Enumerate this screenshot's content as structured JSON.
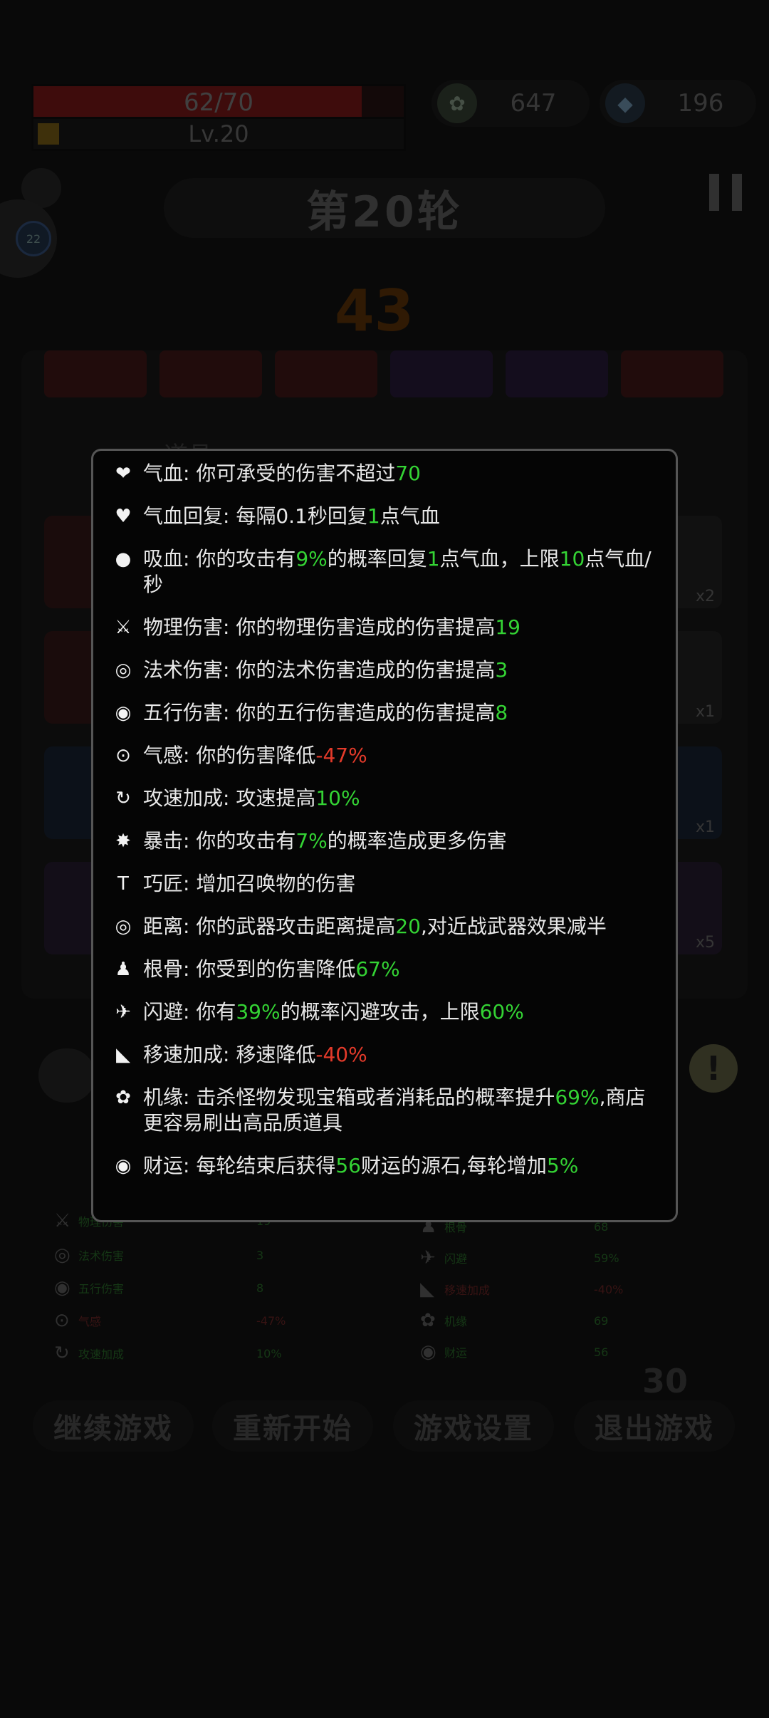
{
  "hud": {
    "hp_text": "62/70",
    "hp_fraction": 0.886,
    "level_text": "Lv.20",
    "currency1": "647",
    "currency2": "196",
    "round_title": "第20轮",
    "countdown": "43",
    "float_badge": "22"
  },
  "background": {
    "section_label": "道具",
    "tile_qty": [
      "x2",
      "x1",
      "x1",
      "x5"
    ],
    "counter": "30",
    "stats_left": [
      {
        "name": "物理伤害",
        "value": "19"
      },
      {
        "name": "法术伤害",
        "value": "3"
      },
      {
        "name": "五行伤害",
        "value": "8"
      },
      {
        "name": "气感",
        "value": "-47%"
      },
      {
        "name": "攻速加成",
        "value": "10%"
      }
    ],
    "stats_right": [
      {
        "name": "根骨",
        "value": "68"
      },
      {
        "name": "闪避",
        "value": "59%"
      },
      {
        "name": "移速加成",
        "value": "-40%"
      },
      {
        "name": "机缘",
        "value": "69"
      },
      {
        "name": "财运",
        "value": "56"
      }
    ]
  },
  "tooltip": {
    "rows": [
      {
        "icon": "heart-icon",
        "glyph": "❤",
        "parts": [
          {
            "t": "气血: 你可承受的伤害不超过"
          },
          {
            "t": "70",
            "c": "g"
          }
        ]
      },
      {
        "icon": "heart-regen-icon",
        "glyph": "♥",
        "parts": [
          {
            "t": "气血回复: 每隔0.1秒回复"
          },
          {
            "t": "1",
            "c": "g"
          },
          {
            "t": "点气血"
          }
        ]
      },
      {
        "icon": "blood-drop-icon",
        "glyph": "●",
        "parts": [
          {
            "t": "吸血: 你的攻击有"
          },
          {
            "t": "9%",
            "c": "g"
          },
          {
            "t": "的概率回复"
          },
          {
            "t": "1",
            "c": "g"
          },
          {
            "t": "点气血，上限"
          },
          {
            "t": "10",
            "c": "g"
          },
          {
            "t": "点气血/秒"
          }
        ]
      },
      {
        "icon": "sword-icon",
        "glyph": "⚔",
        "parts": [
          {
            "t": "物理伤害: 你的物理伤害造成的伤害提高"
          },
          {
            "t": "19",
            "c": "g"
          }
        ]
      },
      {
        "icon": "swirl-icon",
        "glyph": "◎",
        "parts": [
          {
            "t": "法术伤害: 你的法术伤害造成的伤害提高"
          },
          {
            "t": "3",
            "c": "g"
          }
        ]
      },
      {
        "icon": "five-elements-icon",
        "glyph": "◉",
        "parts": [
          {
            "t": "五行伤害: 你的五行伤害造成的伤害提高"
          },
          {
            "t": "8",
            "c": "g"
          }
        ]
      },
      {
        "icon": "qi-sense-icon",
        "glyph": "⊙",
        "parts": [
          {
            "t": "气感: 你的伤害降低"
          },
          {
            "t": "-47%",
            "c": "r"
          }
        ]
      },
      {
        "icon": "attack-speed-icon",
        "glyph": "↻",
        "parts": [
          {
            "t": "攻速加成: 攻速提高"
          },
          {
            "t": "10%",
            "c": "g"
          }
        ]
      },
      {
        "icon": "critical-icon",
        "glyph": "✸",
        "parts": [
          {
            "t": "暴击: 你的攻击有"
          },
          {
            "t": "7%",
            "c": "g"
          },
          {
            "t": "的概率造成更多伤害"
          }
        ]
      },
      {
        "icon": "hammer-icon",
        "glyph": "T",
        "parts": [
          {
            "t": "巧匠: 增加召唤物的伤害"
          }
        ]
      },
      {
        "icon": "range-icon",
        "glyph": "◎",
        "parts": [
          {
            "t": "距离: 你的武器攻击距离提高"
          },
          {
            "t": "20",
            "c": "g"
          },
          {
            "t": ",对近战武器效果减半"
          }
        ]
      },
      {
        "icon": "meditation-icon",
        "glyph": "♟",
        "parts": [
          {
            "t": "根骨: 你受到的伤害降低"
          },
          {
            "t": "67%",
            "c": "g"
          }
        ]
      },
      {
        "icon": "dodge-icon",
        "glyph": "✈",
        "parts": [
          {
            "t": "闪避: 你有"
          },
          {
            "t": "39%",
            "c": "g"
          },
          {
            "t": "的概率闪避攻击，上限"
          },
          {
            "t": "60%",
            "c": "g"
          }
        ]
      },
      {
        "icon": "boot-icon",
        "glyph": "◣",
        "parts": [
          {
            "t": "移速加成: 移速降低"
          },
          {
            "t": "-40%",
            "c": "r"
          }
        ]
      },
      {
        "icon": "fortune-cycle-icon",
        "glyph": "✿",
        "parts": [
          {
            "t": "机缘: 击杀怪物发现宝箱或者消耗品的概率提升"
          },
          {
            "t": "69%",
            "c": "g"
          },
          {
            "t": ",商店更容易刷出高品质道具"
          }
        ]
      },
      {
        "icon": "coin-icon",
        "glyph": "◉",
        "parts": [
          {
            "t": "财运: 每轮结束后获得"
          },
          {
            "t": "56",
            "c": "g"
          },
          {
            "t": "财运的源石,每轮增加"
          },
          {
            "t": "5%",
            "c": "g"
          }
        ]
      }
    ]
  },
  "menu": {
    "continue": "继续游戏",
    "restart": "重新开始",
    "settings": "游戏设置",
    "quit": "退出游戏"
  }
}
